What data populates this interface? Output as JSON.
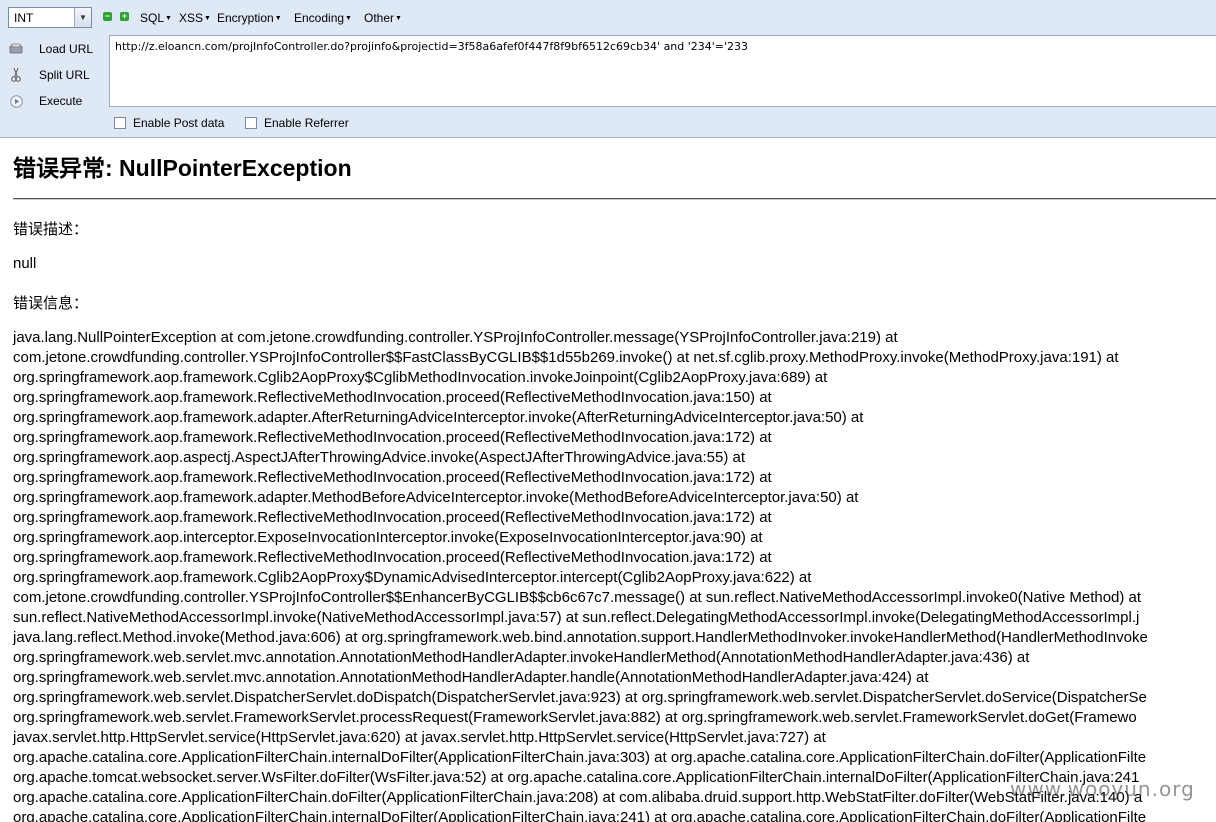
{
  "toolbar": {
    "select_value": "INT",
    "minus_label": "−",
    "plus_label": "+",
    "menus": [
      "SQL",
      "XSS",
      "Encryption",
      "Encoding",
      "Other"
    ]
  },
  "sidebar": {
    "items": [
      {
        "label": "Load URL",
        "icon": "load-url-icon"
      },
      {
        "label": "Split URL",
        "icon": "scissors-icon"
      },
      {
        "label": "Execute",
        "icon": "execute-icon"
      }
    ]
  },
  "url": {
    "value": "http://z.eloancn.com/projInfoController.do?projinfo&projectid=3f58a6afef0f447f8f9bf6512c69cb34' and '234'='233"
  },
  "options": {
    "post_data_label": "Enable Post data",
    "referrer_label": "Enable Referrer"
  },
  "page": {
    "title": "错误异常: NullPointerException",
    "desc_label": "错误描述：",
    "desc_value": "null",
    "info_label": "错误信息：",
    "stack": [
      "java.lang.NullPointerException at com.jetone.crowdfunding.controller.YSProjInfoController.message(YSProjInfoController.java:219) at",
      "com.jetone.crowdfunding.controller.YSProjInfoController$$FastClassByCGLIB$$1d55b269.invoke() at net.sf.cglib.proxy.MethodProxy.invoke(MethodProxy.java:191) at",
      "org.springframework.aop.framework.Cglib2AopProxy$CglibMethodInvocation.invokeJoinpoint(Cglib2AopProxy.java:689) at",
      "org.springframework.aop.framework.ReflectiveMethodInvocation.proceed(ReflectiveMethodInvocation.java:150) at",
      "org.springframework.aop.framework.adapter.AfterReturningAdviceInterceptor.invoke(AfterReturningAdviceInterceptor.java:50) at",
      "org.springframework.aop.framework.ReflectiveMethodInvocation.proceed(ReflectiveMethodInvocation.java:172) at",
      "org.springframework.aop.aspectj.AspectJAfterThrowingAdvice.invoke(AspectJAfterThrowingAdvice.java:55) at",
      "org.springframework.aop.framework.ReflectiveMethodInvocation.proceed(ReflectiveMethodInvocation.java:172) at",
      "org.springframework.aop.framework.adapter.MethodBeforeAdviceInterceptor.invoke(MethodBeforeAdviceInterceptor.java:50) at",
      "org.springframework.aop.framework.ReflectiveMethodInvocation.proceed(ReflectiveMethodInvocation.java:172) at",
      "org.springframework.aop.interceptor.ExposeInvocationInterceptor.invoke(ExposeInvocationInterceptor.java:90) at",
      "org.springframework.aop.framework.ReflectiveMethodInvocation.proceed(ReflectiveMethodInvocation.java:172) at",
      "org.springframework.aop.framework.Cglib2AopProxy$DynamicAdvisedInterceptor.intercept(Cglib2AopProxy.java:622) at",
      "com.jetone.crowdfunding.controller.YSProjInfoController$$EnhancerByCGLIB$$cb6c67c7.message() at sun.reflect.NativeMethodAccessorImpl.invoke0(Native Method) at",
      "sun.reflect.NativeMethodAccessorImpl.invoke(NativeMethodAccessorImpl.java:57) at sun.reflect.DelegatingMethodAccessorImpl.invoke(DelegatingMethodAccessorImpl.j",
      "java.lang.reflect.Method.invoke(Method.java:606) at org.springframework.web.bind.annotation.support.HandlerMethodInvoker.invokeHandlerMethod(HandlerMethodInvoke",
      "org.springframework.web.servlet.mvc.annotation.AnnotationMethodHandlerAdapter.invokeHandlerMethod(AnnotationMethodHandlerAdapter.java:436) at",
      "org.springframework.web.servlet.mvc.annotation.AnnotationMethodHandlerAdapter.handle(AnnotationMethodHandlerAdapter.java:424) at",
      "org.springframework.web.servlet.DispatcherServlet.doDispatch(DispatcherServlet.java:923) at org.springframework.web.servlet.DispatcherServlet.doService(DispatcherSe",
      "org.springframework.web.servlet.FrameworkServlet.processRequest(FrameworkServlet.java:882) at org.springframework.web.servlet.FrameworkServlet.doGet(Framewo",
      "javax.servlet.http.HttpServlet.service(HttpServlet.java:620) at javax.servlet.http.HttpServlet.service(HttpServlet.java:727) at",
      "org.apache.catalina.core.ApplicationFilterChain.internalDoFilter(ApplicationFilterChain.java:303) at org.apache.catalina.core.ApplicationFilterChain.doFilter(ApplicationFilte",
      "org.apache.tomcat.websocket.server.WsFilter.doFilter(WsFilter.java:52) at org.apache.catalina.core.ApplicationFilterChain.internalDoFilter(ApplicationFilterChain.java:241",
      "org.apache.catalina.core.ApplicationFilterChain.doFilter(ApplicationFilterChain.java:208) at com.alibaba.druid.support.http.WebStatFilter.doFilter(WebStatFilter.java:140) a",
      "org.apache.catalina.core.ApplicationFilterChain.internalDoFilter(ApplicationFilterChain.java:241) at org.apache.catalina.core.ApplicationFilterChain.doFilter(ApplicationFilte"
    ],
    "watermark": "www.wooyun.org"
  }
}
